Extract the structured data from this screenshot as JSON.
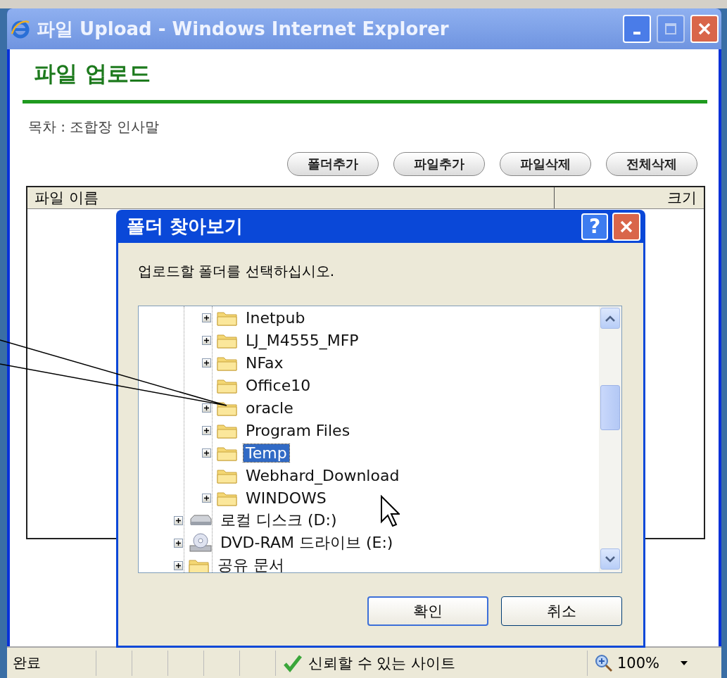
{
  "window": {
    "title": "파일 Upload - Windows Internet Explorer",
    "controls": [
      {
        "kind": "minimize",
        "disabled": false
      },
      {
        "kind": "maximize",
        "disabled": true
      },
      {
        "kind": "close",
        "disabled": false
      }
    ]
  },
  "page": {
    "heading": "파일 업로드",
    "subtitle": "목차 : 조합장 인사말",
    "buttons": [
      "폴더추가",
      "파일추가",
      "파일삭제",
      "전체삭제"
    ],
    "table": {
      "columns": [
        "파일 이름",
        "크기"
      ]
    }
  },
  "dialog": {
    "title": "폴더 찾아보기",
    "help_button": "?",
    "prompt": "업로드할 폴더를 선택하십시오.",
    "tree": [
      {
        "children": [
          {
            "children": [
              {
                "label": "Inetpub",
                "kind": "folder",
                "expandable": true,
                "selected": false
              },
              {
                "label": "LJ_M4555_MFP",
                "kind": "folder",
                "expandable": true,
                "selected": false
              },
              {
                "label": "NFax",
                "kind": "folder",
                "expandable": true,
                "selected": false
              },
              {
                "label": "Office10",
                "kind": "folder",
                "expandable": false,
                "selected": false
              },
              {
                "label": "oracle",
                "kind": "folder",
                "expandable": true,
                "selected": false
              },
              {
                "label": "Program Files",
                "kind": "folder",
                "expandable": true,
                "selected": false
              },
              {
                "label": "Temp",
                "kind": "folder",
                "expandable": true,
                "selected": true
              },
              {
                "label": "Webhard_Download",
                "kind": "folder",
                "expandable": false,
                "selected": false
              },
              {
                "label": "WINDOWS",
                "kind": "folder",
                "expandable": true,
                "selected": false
              }
            ]
          },
          {
            "label": "로컬 디스크 (D:)",
            "kind": "drive",
            "expandable": true,
            "selected": false
          },
          {
            "label": "DVD-RAM 드라이브 (E:)",
            "kind": "disc",
            "expandable": true,
            "selected": false
          },
          {
            "label": "공유 문서",
            "kind": "folder",
            "expandable": true,
            "selected": false
          }
        ]
      }
    ],
    "buttons": [
      {
        "label": "확인",
        "default": true
      },
      {
        "label": "취소",
        "default": false
      }
    ]
  },
  "status_bar": {
    "text": "완료",
    "zone": "신뢰할 수 있는 사이트",
    "zoom": "100%"
  }
}
